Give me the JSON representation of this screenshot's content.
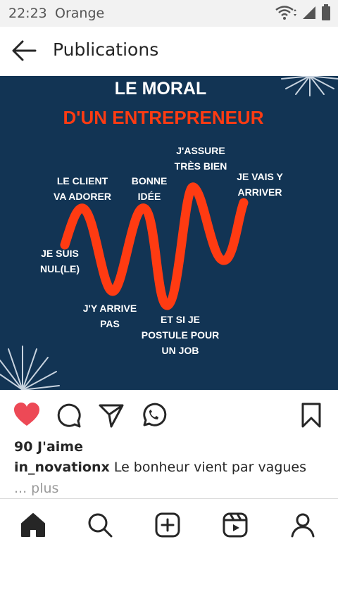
{
  "status_bar": {
    "time": "22:23",
    "carrier": "Orange",
    "icons": [
      "wifi-icon",
      "signal-icon",
      "battery-icon"
    ]
  },
  "header": {
    "title": "Publications",
    "back_icon": "arrow-left-icon"
  },
  "post": {
    "image": {
      "title_line1": "LE MORAL",
      "title_line2": "D'UN ENTREPRENEUR",
      "background_color": "#123454",
      "accent_color": "#ff3b12",
      "labels": {
        "je_suis_nul": [
          "JE SUIS",
          "NUL(LE)"
        ],
        "le_client": [
          "LE CLIENT",
          "VA ADORER"
        ],
        "jy_arrive_pas": [
          "J'Y ARRIVE",
          "PAS"
        ],
        "bonne_idee": [
          "BONNE",
          "IDÉE"
        ],
        "et_si_je": [
          "ET SI JE",
          "POSTULE POUR",
          "UN JOB"
        ],
        "jassure": [
          "J'ASSURE",
          "TRÈS BIEN"
        ],
        "je_vais_y": [
          "JE VAIS Y",
          "ARRIVER"
        ]
      }
    },
    "actions": {
      "like_icon": "heart-filled-icon",
      "comment_icon": "comment-icon",
      "share_icon": "send-icon",
      "whatsapp_icon": "whatsapp-icon",
      "save_icon": "bookmark-icon",
      "like_color": "#ed4956"
    },
    "likes_text": "90 J'aime",
    "caption_user": "in_novationx",
    "caption_text": "Le bonheur vient par vagues",
    "more_text": "... plus"
  },
  "bottom_nav": {
    "items": [
      "home-icon",
      "search-icon",
      "add-post-icon",
      "reels-icon",
      "profile-icon"
    ]
  }
}
